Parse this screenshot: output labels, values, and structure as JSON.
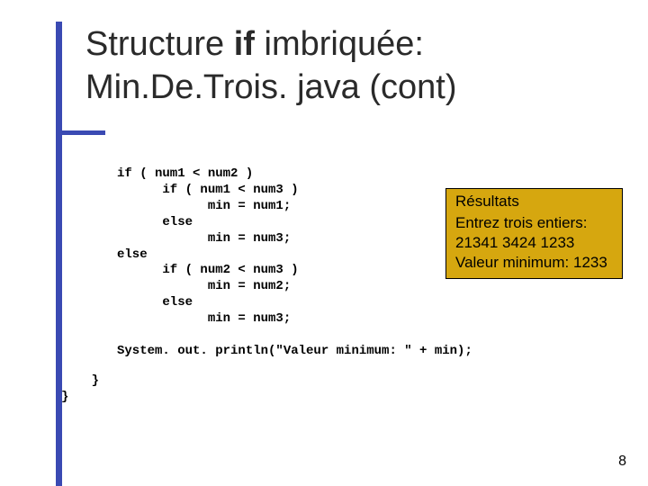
{
  "title": {
    "line1_pre": "Structure ",
    "line1_kw": "if",
    "line1_post": " imbriquée:",
    "line2": "Min.De.Trois. java (cont)"
  },
  "code": "if ( num1 < num2 )\n      if ( num1 < num3 )\n            min = num1;\n      else\n            min = num3;\nelse\n      if ( num2 < num3 )\n            min = num2;\n      else\n            min = num3;\n\nSystem. out. println(\"Valeur minimum: \" + min);",
  "code_tail": "    }\n}",
  "results": {
    "heading": "Résultats",
    "line1": "Entrez trois entiers:",
    "line2": "21341  3424  1233",
    "line3": "Valeur minimum: 1233"
  },
  "page_number": "8"
}
